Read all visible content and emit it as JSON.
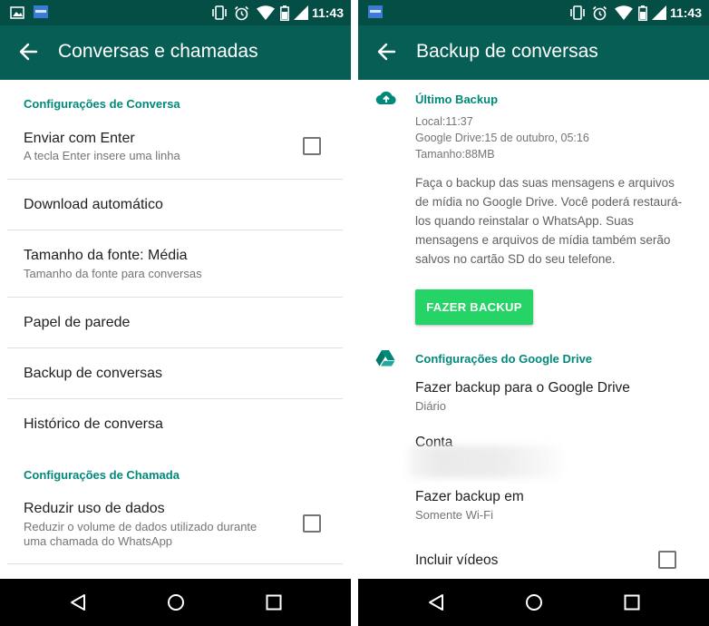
{
  "status_bar": {
    "time": "11:43",
    "icons": [
      "image-icon",
      "app-notification-icon",
      "vibrate-icon",
      "alarm-icon",
      "wifi-icon",
      "battery-icon",
      "signal-icon"
    ]
  },
  "left": {
    "title": "Conversas e chamadas",
    "section_chat": "Configurações de Conversa",
    "enter_title": "Enviar com Enter",
    "enter_sub": "A tecla Enter insere uma linha",
    "download_title": "Download automático",
    "font_title": "Tamanho da fonte: Média",
    "font_sub": "Tamanho da fonte para conversas",
    "wallpaper_title": "Papel de parede",
    "backup_title": "Backup de conversas",
    "history_title": "Histórico de conversa",
    "section_call": "Configurações de Chamada",
    "data_title": "Reduzir uso de dados",
    "data_sub_line1": "Reduzir o volume de dados utilizado durante",
    "data_sub_line2": "uma chamada do WhatsApp"
  },
  "right": {
    "title": "Backup de conversas",
    "last_backup_header": "Último Backup",
    "local": "Local:11:37",
    "google_drive": "Google Drive:15 de outubro, 05:16",
    "size": "Tamanho:88MB",
    "description": "Faça o backup das suas mensagens e arquivos de mídia no Google Drive. Você poderá restaurá-los quando reinstalar o WhatsApp. Suas mensagens e arquivos de mídia também serão salvos no cartão SD do seu telefone.",
    "backup_button": "FAZER BACKUP",
    "drive_header": "Configurações do Google Drive",
    "freq_title": "Fazer backup para o Google Drive",
    "freq_value": "Diário",
    "account_title": "Conta",
    "network_title": "Fazer backup em",
    "network_value": "Somente Wi-Fi",
    "videos_title": "Incluir vídeos"
  },
  "colors": {
    "status_bar": "#054e45",
    "app_bar": "#075e54",
    "accent": "#00897b",
    "button": "#25d366"
  }
}
